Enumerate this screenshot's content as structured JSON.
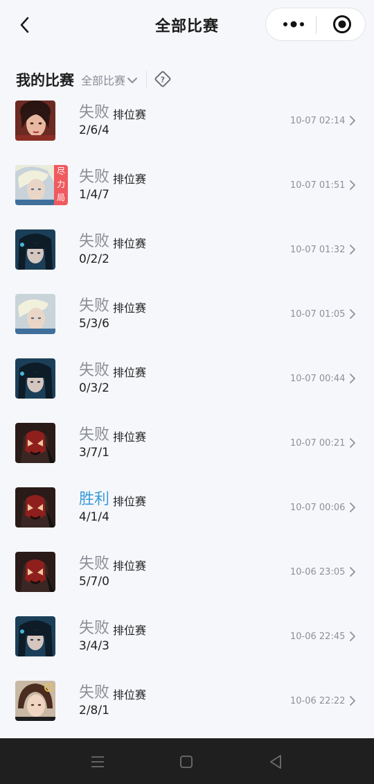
{
  "header": {
    "title": "全部比赛"
  },
  "section": {
    "title": "我的比赛",
    "filter": "全部比赛"
  },
  "matches": [
    {
      "result": "失败",
      "mode": "排位赛",
      "kda": "2/6/4",
      "time": "10-07 02:14",
      "hero": "hero-a",
      "win": false
    },
    {
      "result": "失败",
      "mode": "排位赛",
      "kda": "1/4/7",
      "time": "10-07 01:51",
      "hero": "hero-b",
      "win": false,
      "badge": "尽力局"
    },
    {
      "result": "失败",
      "mode": "排位赛",
      "kda": "0/2/2",
      "time": "10-07 01:32",
      "hero": "hero-c",
      "win": false
    },
    {
      "result": "失败",
      "mode": "排位赛",
      "kda": "5/3/6",
      "time": "10-07 01:05",
      "hero": "hero-b",
      "win": false
    },
    {
      "result": "失败",
      "mode": "排位赛",
      "kda": "0/3/2",
      "time": "10-07 00:44",
      "hero": "hero-c",
      "win": false
    },
    {
      "result": "失败",
      "mode": "排位赛",
      "kda": "3/7/1",
      "time": "10-07 00:21",
      "hero": "hero-d",
      "win": false
    },
    {
      "result": "胜利",
      "mode": "排位赛",
      "kda": "4/1/4",
      "time": "10-07 00:06",
      "hero": "hero-d",
      "win": true
    },
    {
      "result": "失败",
      "mode": "排位赛",
      "kda": "5/7/0",
      "time": "10-06 23:05",
      "hero": "hero-d",
      "win": false
    },
    {
      "result": "失败",
      "mode": "排位赛",
      "kda": "3/4/3",
      "time": "10-06 22:45",
      "hero": "hero-c",
      "win": false
    },
    {
      "result": "失败",
      "mode": "排位赛",
      "kda": "2/8/1",
      "time": "10-06 22:22",
      "hero": "hero-e",
      "win": false
    }
  ],
  "colors": {
    "win": "#3a9ad8",
    "loss": "#8b8e96",
    "badge": "#ef5a5f",
    "background": "#f6f7fb"
  },
  "icons": {
    "back": "chevron-left-icon",
    "more": "more-dots-icon",
    "close": "target-close-icon",
    "filter": "chevron-down-icon",
    "help": "help-diamond-icon",
    "row_arrow": "chevron-right-icon",
    "nav": [
      "menu-icon",
      "home-square-icon",
      "back-triangle-icon"
    ]
  }
}
